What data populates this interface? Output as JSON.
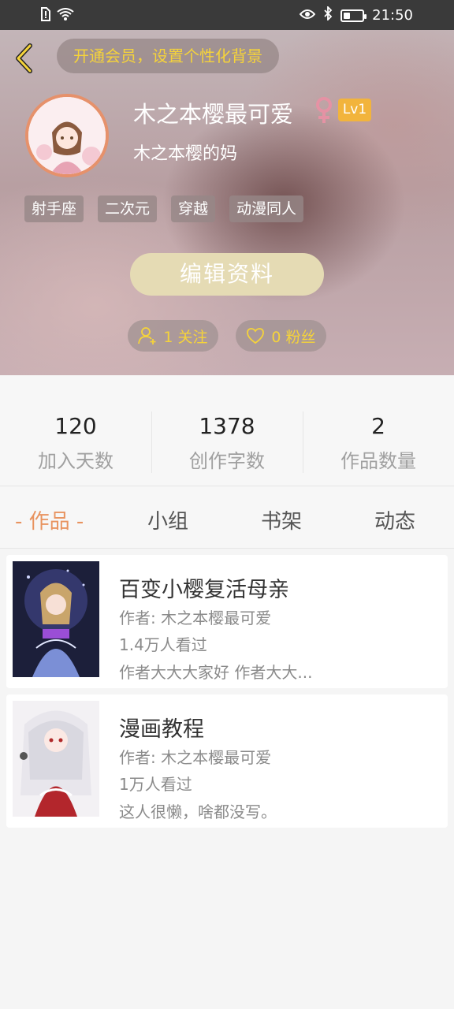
{
  "status_bar": {
    "time": "21:50",
    "battery_level": 0.35
  },
  "header": {
    "vip_prompt": "开通会员，设置个性化背景",
    "nickname": "木之本樱最可爱",
    "level": "Lv1",
    "subtitle": "木之本樱的妈",
    "tags": [
      "射手座",
      "二次元",
      "穿越",
      "动漫同人"
    ],
    "edit_button": "编辑资料",
    "following_label": "1 关注",
    "fans_label": "0 粉丝"
  },
  "stats": [
    {
      "value": "120",
      "label": "加入天数"
    },
    {
      "value": "1378",
      "label": "创作字数"
    },
    {
      "value": "2",
      "label": "作品数量"
    }
  ],
  "tabs": [
    "- 作品 -",
    "小组",
    "书架",
    "动态"
  ],
  "works": [
    {
      "title": "百变小樱复活母亲",
      "author": "作者: 木之本樱最可爱",
      "views": "1.4万人看过",
      "description": "作者大大大家好 作者大大..."
    },
    {
      "title": "漫画教程",
      "author": "作者: 木之本樱最可爱",
      "views": "1万人看过",
      "description": "这人很懒，啥都没写。"
    }
  ],
  "colors": {
    "accent": "#e8935f",
    "vip_text": "#f5d33a",
    "level_badge": "#f2b43c",
    "gender": "#e592a4"
  }
}
